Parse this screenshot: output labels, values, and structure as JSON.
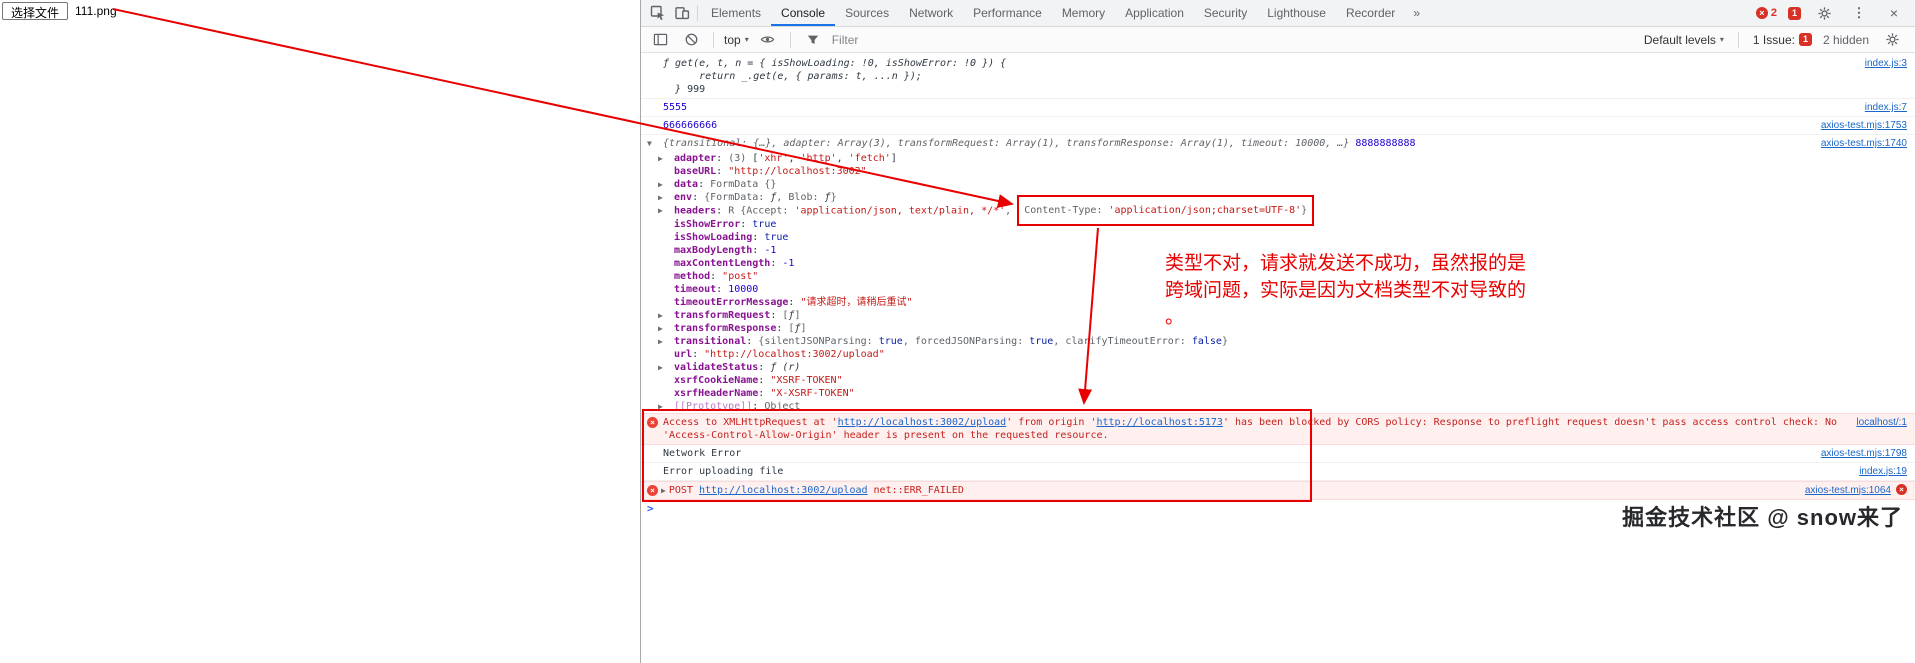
{
  "page": {
    "file_button": "选择文件",
    "file_name": "111.png"
  },
  "devtools": {
    "tabs": [
      "Elements",
      "Console",
      "Sources",
      "Network",
      "Performance",
      "Memory",
      "Application",
      "Security",
      "Lighthouse",
      "Recorder"
    ],
    "active_tab": "Console",
    "more_tabs": "»",
    "error_badge": "2",
    "issue_badge": "1",
    "toolbar": {
      "context": "top",
      "filter_placeholder": "Filter",
      "levels": "Default levels",
      "issue_label": "1 Issue:",
      "issue_count": "1",
      "hidden": "2 hidden"
    },
    "console": {
      "prompt": ">",
      "rows": [
        {
          "name": "log-function",
          "border": true,
          "link": "index.js:3",
          "parts": [
            [
              "ƒ get(e, t, n = { isShowLoading: !0, isShowError: !0 }) {\n      return _.get(e, { params: t, ...n });\n  } ",
              "fn"
            ],
            [
              "999",
              "plain"
            ]
          ]
        },
        {
          "name": "log-5555",
          "border": true,
          "link": "index.js:7",
          "parts": [
            [
              "5555",
              "n"
            ]
          ]
        },
        {
          "name": "log-666666666",
          "border": true,
          "link": "axios-test.mjs:1753",
          "parts": [
            [
              "666666666",
              "n"
            ]
          ]
        },
        {
          "name": "log-config-object",
          "arrow": "open",
          "link": "axios-test.mjs:1740",
          "parts": [
            [
              "{transitional: {…}, adapter: Array(3), transformRequest: Array(1), transformResponse: Array(1), timeout: 10000, …}",
              "prev"
            ],
            [
              " 8888888888",
              "n"
            ]
          ]
        },
        {
          "name": "prop-adapter",
          "indent": 1,
          "arrow": "closed",
          "parts": [
            [
              "adapter",
              "k"
            ],
            [
              ": ",
              "plain"
            ],
            [
              "(3) ",
              "gray"
            ],
            [
              "[",
              "plain"
            ],
            [
              "'xhr'",
              "s"
            ],
            [
              ", ",
              "plain"
            ],
            [
              "'http'",
              "s"
            ],
            [
              ", ",
              "plain"
            ],
            [
              "'fetch'",
              "s"
            ],
            [
              "]",
              "plain"
            ]
          ]
        },
        {
          "name": "prop-baseURL",
          "indent": 1,
          "parts": [
            [
              "baseURL",
              "k"
            ],
            [
              ": ",
              "plain"
            ],
            [
              "\"http://localhost:3002\"",
              "s"
            ]
          ]
        },
        {
          "name": "prop-data",
          "indent": 1,
          "arrow": "closed",
          "parts": [
            [
              "data",
              "k"
            ],
            [
              ": ",
              "plain"
            ],
            [
              "FormData {}",
              "gray"
            ]
          ]
        },
        {
          "name": "prop-env",
          "indent": 1,
          "arrow": "closed",
          "parts": [
            [
              "env",
              "k"
            ],
            [
              ": ",
              "plain"
            ],
            [
              "{FormData: ",
              "gray"
            ],
            [
              "ƒ",
              "fn"
            ],
            [
              ", Blob: ",
              "gray"
            ],
            [
              "ƒ",
              "fn"
            ],
            [
              "}",
              "gray"
            ]
          ]
        },
        {
          "name": "prop-headers",
          "indent": 1,
          "arrow": "closed",
          "parts": [
            [
              "headers",
              "k"
            ],
            [
              ": ",
              "plain"
            ],
            [
              "R ",
              "gray"
            ],
            [
              "{Accept: ",
              "gray"
            ],
            [
              "'application/json, text/plain, */*'",
              "s"
            ],
            [
              ", ",
              "gray"
            ]
          ],
          "box_parts": [
            [
              "Content-Type: ",
              "gray"
            ],
            [
              "'application/json;charset=UTF-8'",
              "s"
            ],
            [
              "}",
              "gray"
            ]
          ]
        },
        {
          "name": "prop-isShowError",
          "indent": 1,
          "parts": [
            [
              "isShowError",
              "k"
            ],
            [
              ": ",
              "plain"
            ],
            [
              "true",
              "b"
            ]
          ]
        },
        {
          "name": "prop-isShowLoading",
          "indent": 1,
          "parts": [
            [
              "isShowLoading",
              "k"
            ],
            [
              ": ",
              "plain"
            ],
            [
              "true",
              "b"
            ]
          ]
        },
        {
          "name": "prop-maxBodyLength",
          "indent": 1,
          "parts": [
            [
              "maxBodyLength",
              "k"
            ],
            [
              ": ",
              "plain"
            ],
            [
              "-1",
              "n"
            ]
          ]
        },
        {
          "name": "prop-maxContentLength",
          "indent": 1,
          "parts": [
            [
              "maxContentLength",
              "k"
            ],
            [
              ": ",
              "plain"
            ],
            [
              "-1",
              "n"
            ]
          ]
        },
        {
          "name": "prop-method",
          "indent": 1,
          "parts": [
            [
              "method",
              "k"
            ],
            [
              ": ",
              "plain"
            ],
            [
              "\"post\"",
              "s"
            ]
          ]
        },
        {
          "name": "prop-timeout",
          "indent": 1,
          "parts": [
            [
              "timeout",
              "k"
            ],
            [
              ": ",
              "plain"
            ],
            [
              "10000",
              "n"
            ]
          ]
        },
        {
          "name": "prop-timeoutErrorMessage",
          "indent": 1,
          "parts": [
            [
              "timeoutErrorMessage",
              "k"
            ],
            [
              ": ",
              "plain"
            ],
            [
              "\"请求超时，请稍后重试\"",
              "s"
            ]
          ]
        },
        {
          "name": "prop-transformRequest",
          "indent": 1,
          "arrow": "closed",
          "parts": [
            [
              "transformRequest",
              "k"
            ],
            [
              ": ",
              "plain"
            ],
            [
              "[",
              "gray"
            ],
            [
              "ƒ",
              "fn"
            ],
            [
              "]",
              "gray"
            ]
          ]
        },
        {
          "name": "prop-transformResponse",
          "indent": 1,
          "arrow": "closed",
          "parts": [
            [
              "transformResponse",
              "k"
            ],
            [
              ": ",
              "plain"
            ],
            [
              "[",
              "gray"
            ],
            [
              "ƒ",
              "fn"
            ],
            [
              "]",
              "gray"
            ]
          ]
        },
        {
          "name": "prop-transitional",
          "indent": 1,
          "arrow": "closed",
          "parts": [
            [
              "transitional",
              "k"
            ],
            [
              ": ",
              "plain"
            ],
            [
              "{silentJSONParsing: ",
              "gray"
            ],
            [
              "true",
              "b"
            ],
            [
              ", forcedJSONParsing: ",
              "gray"
            ],
            [
              "true",
              "b"
            ],
            [
              ", clarifyTimeoutError: ",
              "gray"
            ],
            [
              "false",
              "b"
            ],
            [
              "}",
              "gray"
            ]
          ]
        },
        {
          "name": "prop-url",
          "indent": 1,
          "parts": [
            [
              "url",
              "k"
            ],
            [
              ": ",
              "plain"
            ],
            [
              "\"http://localhost:3002/upload\"",
              "s"
            ]
          ]
        },
        {
          "name": "prop-validateStatus",
          "indent": 1,
          "arrow": "closed",
          "parts": [
            [
              "validateStatus",
              "k"
            ],
            [
              ": ",
              "plain"
            ],
            [
              "ƒ (r)",
              "fn"
            ]
          ]
        },
        {
          "name": "prop-xsrfCookieName",
          "indent": 1,
          "parts": [
            [
              "xsrfCookieName",
              "k"
            ],
            [
              ": ",
              "plain"
            ],
            [
              "\"XSRF-TOKEN\"",
              "s"
            ]
          ]
        },
        {
          "name": "prop-xsrfHeaderName",
          "indent": 1,
          "parts": [
            [
              "xsrfHeaderName",
              "k"
            ],
            [
              ": ",
              "plain"
            ],
            [
              "\"X-XSRF-TOKEN\"",
              "s"
            ]
          ]
        },
        {
          "name": "prop-prototype",
          "indent": 1,
          "arrow": "closed",
          "parts": [
            [
              "[[Prototype]]",
              "kp"
            ],
            [
              ": ",
              "plain"
            ],
            [
              "Object",
              "gray"
            ]
          ]
        },
        {
          "name": "error-cors",
          "type": "error",
          "icon": true,
          "border": true,
          "link": "localhost/:1",
          "parts": [
            [
              "Access to XMLHttpRequest at '",
              "err"
            ],
            [
              "http://localhost:3002/upload",
              "elink"
            ],
            [
              "' from origin '",
              "err"
            ],
            [
              "http://localhost:5173",
              "elink"
            ],
            [
              "' has been blocked by CORS policy: Response to preflight request doesn't pass access control check: No 'Access-Control-Allow-Origin' header is present on the requested resource.",
              "err"
            ]
          ]
        },
        {
          "name": "log-network-error",
          "border": true,
          "link": "axios-test.mjs:1798",
          "parts": [
            [
              "Network Error",
              "plain"
            ]
          ]
        },
        {
          "name": "log-error-uploading-file",
          "border": true,
          "link": "index.js:19",
          "parts": [
            [
              "Error uploading file",
              "plain"
            ]
          ]
        },
        {
          "name": "error-post-failed",
          "type": "error",
          "icon": true,
          "arrow": "closed",
          "border": true,
          "link": "axios-test.mjs:1064",
          "link_icon": true,
          "parts": [
            [
              "POST ",
              "err"
            ],
            [
              "http://localhost:3002/upload",
              "elink"
            ],
            [
              " net::ERR_FAILED",
              "err"
            ]
          ]
        },
        {
          "name": "console-prompt",
          "prompt": true,
          "parts": []
        }
      ]
    }
  },
  "annotations": {
    "note_lines": [
      "类型不对，请求就发送不成功，虽然报的是",
      "跨域问题，实际是因为文档类型不对导致的",
      "。"
    ],
    "accent_color": "#e80000"
  },
  "watermark": "掘金技术社区 @ snow来了"
}
